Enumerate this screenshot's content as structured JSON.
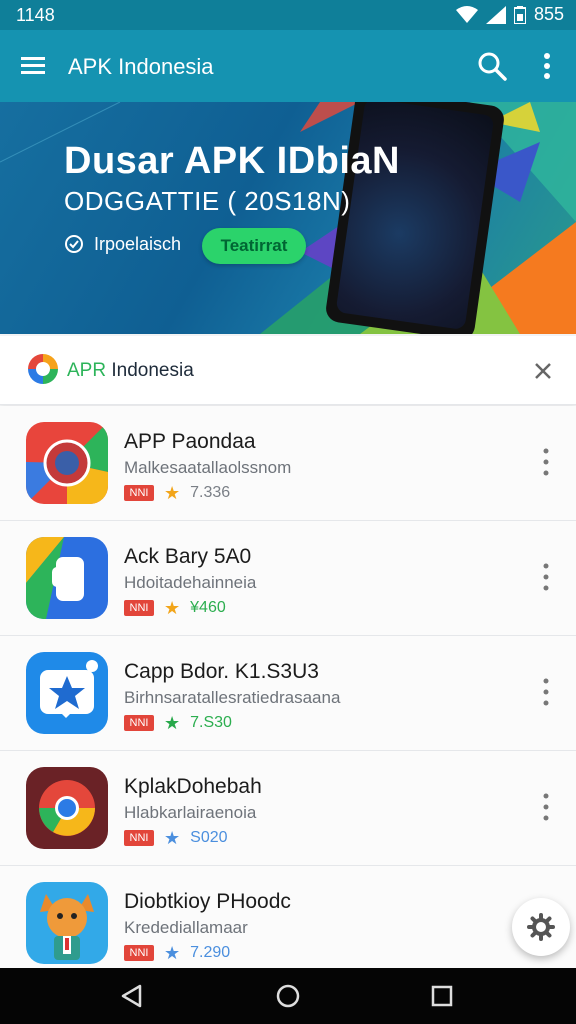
{
  "status_bar": {
    "time": "1148",
    "battery": "855"
  },
  "app_bar": {
    "title": "APK Indonesia",
    "icons": [
      "menu-icon",
      "search-icon",
      "more-vert-icon"
    ]
  },
  "banner": {
    "headline": "Dusar APK IDbiaN",
    "subline": "ODGGATTIE ( 20S18N)",
    "badge_text": "Irpoelaisch",
    "cta_label": "Teatirrat"
  },
  "brand_card": {
    "name_accent": "APR",
    "name_rest": " Indonesia"
  },
  "apps": [
    {
      "title": "APP Paondaa",
      "subtitle": "Malkesaatallaolssnom",
      "tag": "NNI",
      "rating": "7.336",
      "icon": "camera-app-icon",
      "star_color": "#f2a51a",
      "rating_color": "#7a7f86"
    },
    {
      "title": "Ack Bary 5A0",
      "subtitle": "Hdoitadehainneia",
      "tag": "NNI",
      "rating": "¥460",
      "icon": "blue-hand-app-icon",
      "star_color": "#f2a51a",
      "rating_color": "#2cae4f"
    },
    {
      "title": "Capp Bdor. K1.S3U3",
      "subtitle": "Birhnsaratallesratiedrasaana",
      "tag": "NNI",
      "rating": "7.S30",
      "icon": "star-badge-app-icon",
      "star_color": "#27a84a",
      "rating_color": "#2cae4f"
    },
    {
      "title": "KplakDohebah",
      "subtitle": "Hlabkarlairaenoia",
      "tag": "NNI",
      "rating": "S020",
      "icon": "chrome-app-icon",
      "star_color": "#4b8fde",
      "rating_color": "#4b8fde"
    },
    {
      "title": "Diobtkioy PHoodc",
      "subtitle": "Kredediallamaar",
      "tag": "NNI",
      "rating": "7.290",
      "icon": "fox-app-icon",
      "star_color": "#4b8fde",
      "rating_color": "#4b8fde"
    }
  ],
  "fab": {
    "icon": "settings-icon"
  },
  "nav_bar": {
    "icons": [
      "back-icon",
      "home-icon",
      "recents-icon"
    ]
  }
}
